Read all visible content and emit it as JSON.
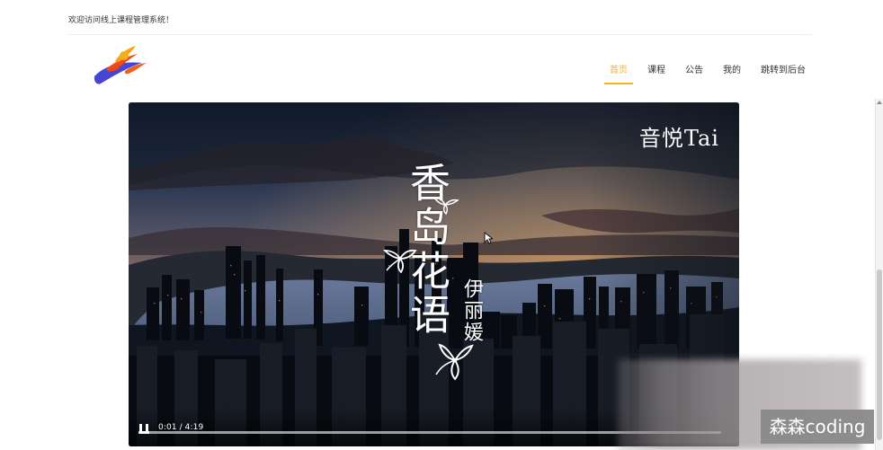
{
  "header": {
    "welcome_text": "欢迎访问线上课程管理系统！",
    "nav_items": [
      {
        "label": "首页",
        "active": true
      },
      {
        "label": "课程",
        "active": false
      },
      {
        "label": "公告",
        "active": false
      },
      {
        "label": "我的",
        "active": false
      },
      {
        "label": "跳转到后台",
        "active": false
      }
    ]
  },
  "video": {
    "channel_text": "音悦Tai",
    "song_title": "香岛花语",
    "artist": "伊丽媛",
    "time_display": "0:01 / 4:19",
    "progress_fraction": 0.018
  },
  "watermark": {
    "text": "森森coding"
  },
  "colors": {
    "accent": "#f2b31b",
    "page_background": "#ffffff",
    "watermark_background": "#8a8a8a"
  },
  "icons": {
    "logo": "logo-icon",
    "pause": "pause-icon",
    "cursor": "mouse-cursor-icon",
    "flower": "flower-icon"
  }
}
